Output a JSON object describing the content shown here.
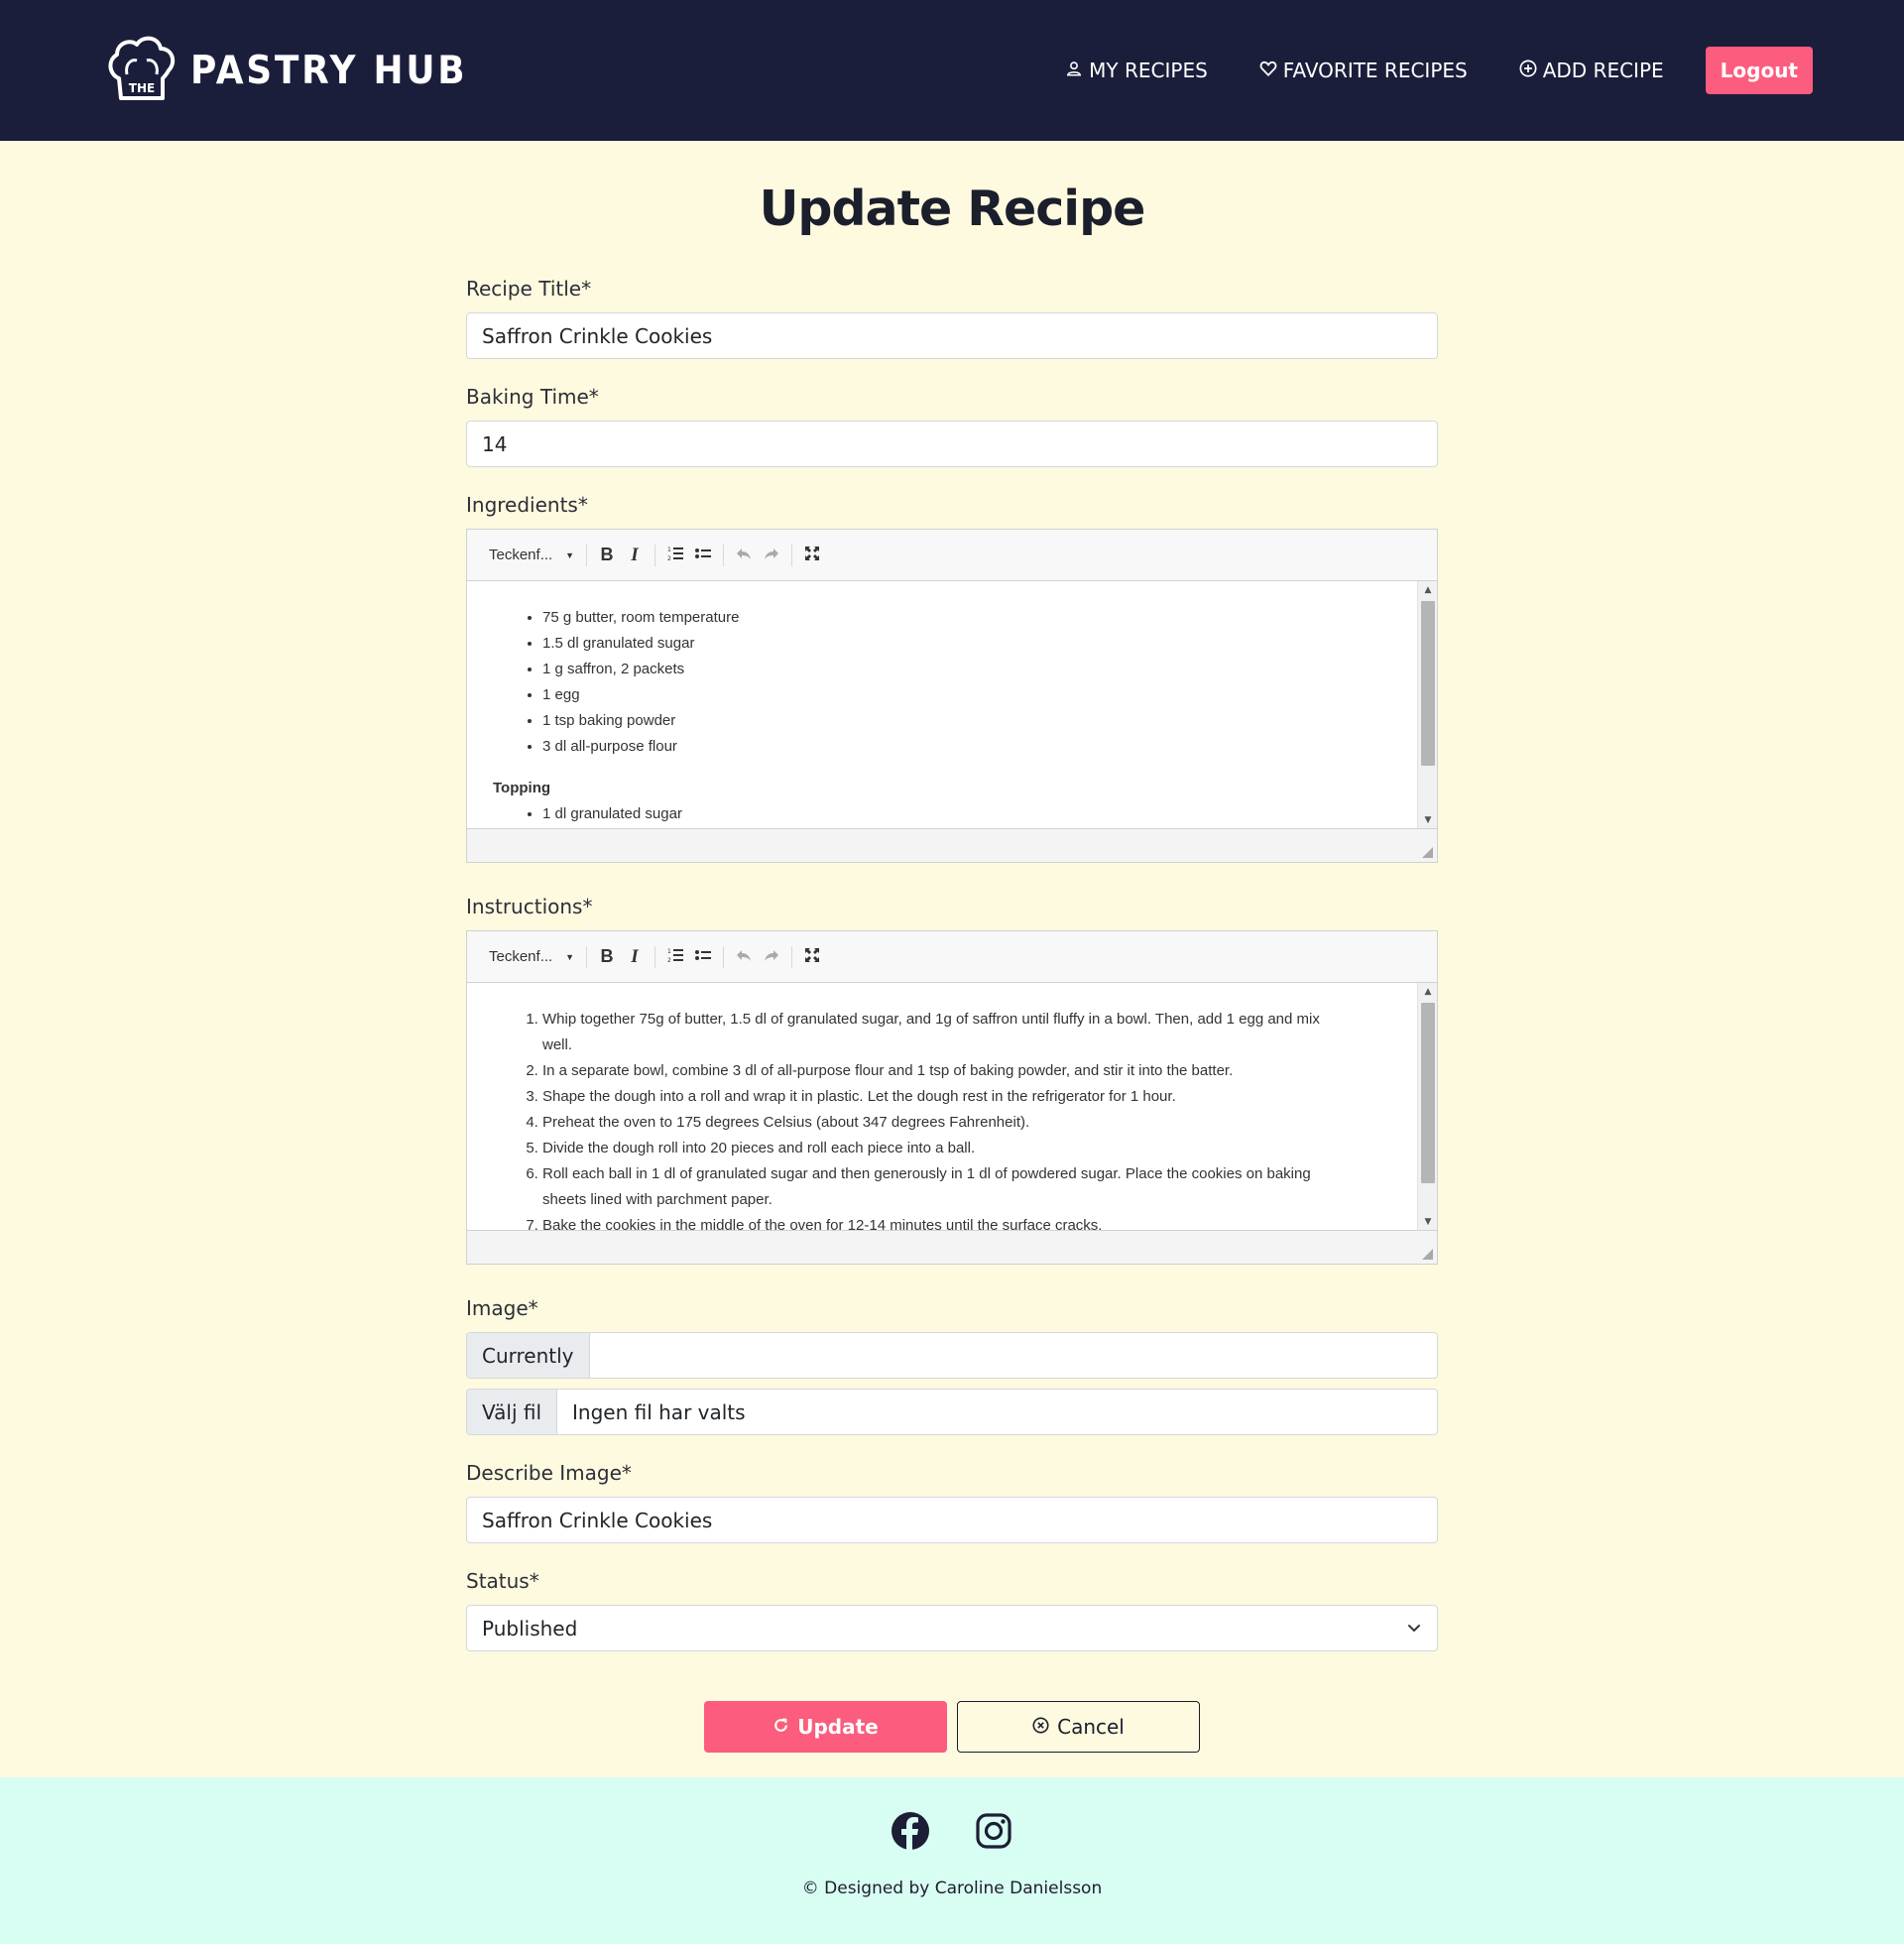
{
  "brand": {
    "the": "THE",
    "name": "PASTRY HUB"
  },
  "nav": {
    "my_recipes": "MY RECIPES",
    "favorite_recipes": "FAVORITE RECIPES",
    "add_recipe": "ADD RECIPE",
    "logout": "Logout"
  },
  "page": {
    "title": "Update Recipe"
  },
  "form": {
    "title_label": "Recipe Title*",
    "title_value": "Saffron Crinkle Cookies",
    "baking_label": "Baking Time*",
    "baking_value": "14",
    "ingredients_label": "Ingredients*",
    "instructions_label": "Instructions*",
    "image_label": "Image*",
    "currently_label": "Currently",
    "currently_value": "",
    "choose_file_label": "Välj fil",
    "no_file_text": "Ingen fil har valts",
    "describe_label": "Describe Image*",
    "describe_value": "Saffron Crinkle Cookies",
    "status_label": "Status*",
    "status_value": "Published"
  },
  "editor": {
    "font_dropdown": "Teckenf...",
    "ingredients": {
      "items": [
        "75 g butter, room temperature",
        "1.5 dl granulated sugar",
        "1 g saffron, 2 packets",
        "1 egg",
        "1 tsp baking powder",
        "3 dl all-purpose flour"
      ],
      "subheading": "Topping",
      "sub_items": [
        "1 dl granulated sugar"
      ],
      "scroll_position": 0.0
    },
    "instructions": {
      "steps": [
        "Whip together 75g of butter, 1.5 dl of granulated sugar, and 1g of saffron until fluffy in a bowl. Then, add 1 egg and mix well.",
        "In a separate bowl, combine 3 dl of all-purpose flour and 1 tsp of baking powder, and stir it into the batter.",
        "Shape the dough into a roll and wrap it in plastic. Let the dough rest in the refrigerator for 1 hour.",
        "Preheat the oven to 175 degrees Celsius (about 347 degrees Fahrenheit).",
        "Divide the dough roll into 20 pieces and roll each piece into a ball.",
        "Roll each ball in 1 dl of granulated sugar and then generously in 1 dl of powdered sugar. Place the cookies on baking sheets lined with parchment paper.",
        "Bake the cookies in the middle of the oven for 12-14 minutes until the surface cracks."
      ],
      "scroll_position": 0.0
    }
  },
  "actions": {
    "update": "Update",
    "cancel": "Cancel"
  },
  "footer": {
    "copyright": "© Designed by Caroline Danielsson"
  },
  "colors": {
    "navbar": "#1b1e3b",
    "accent": "#fc5c7d",
    "background": "#fefae0",
    "footer": "#d8fdf3"
  }
}
